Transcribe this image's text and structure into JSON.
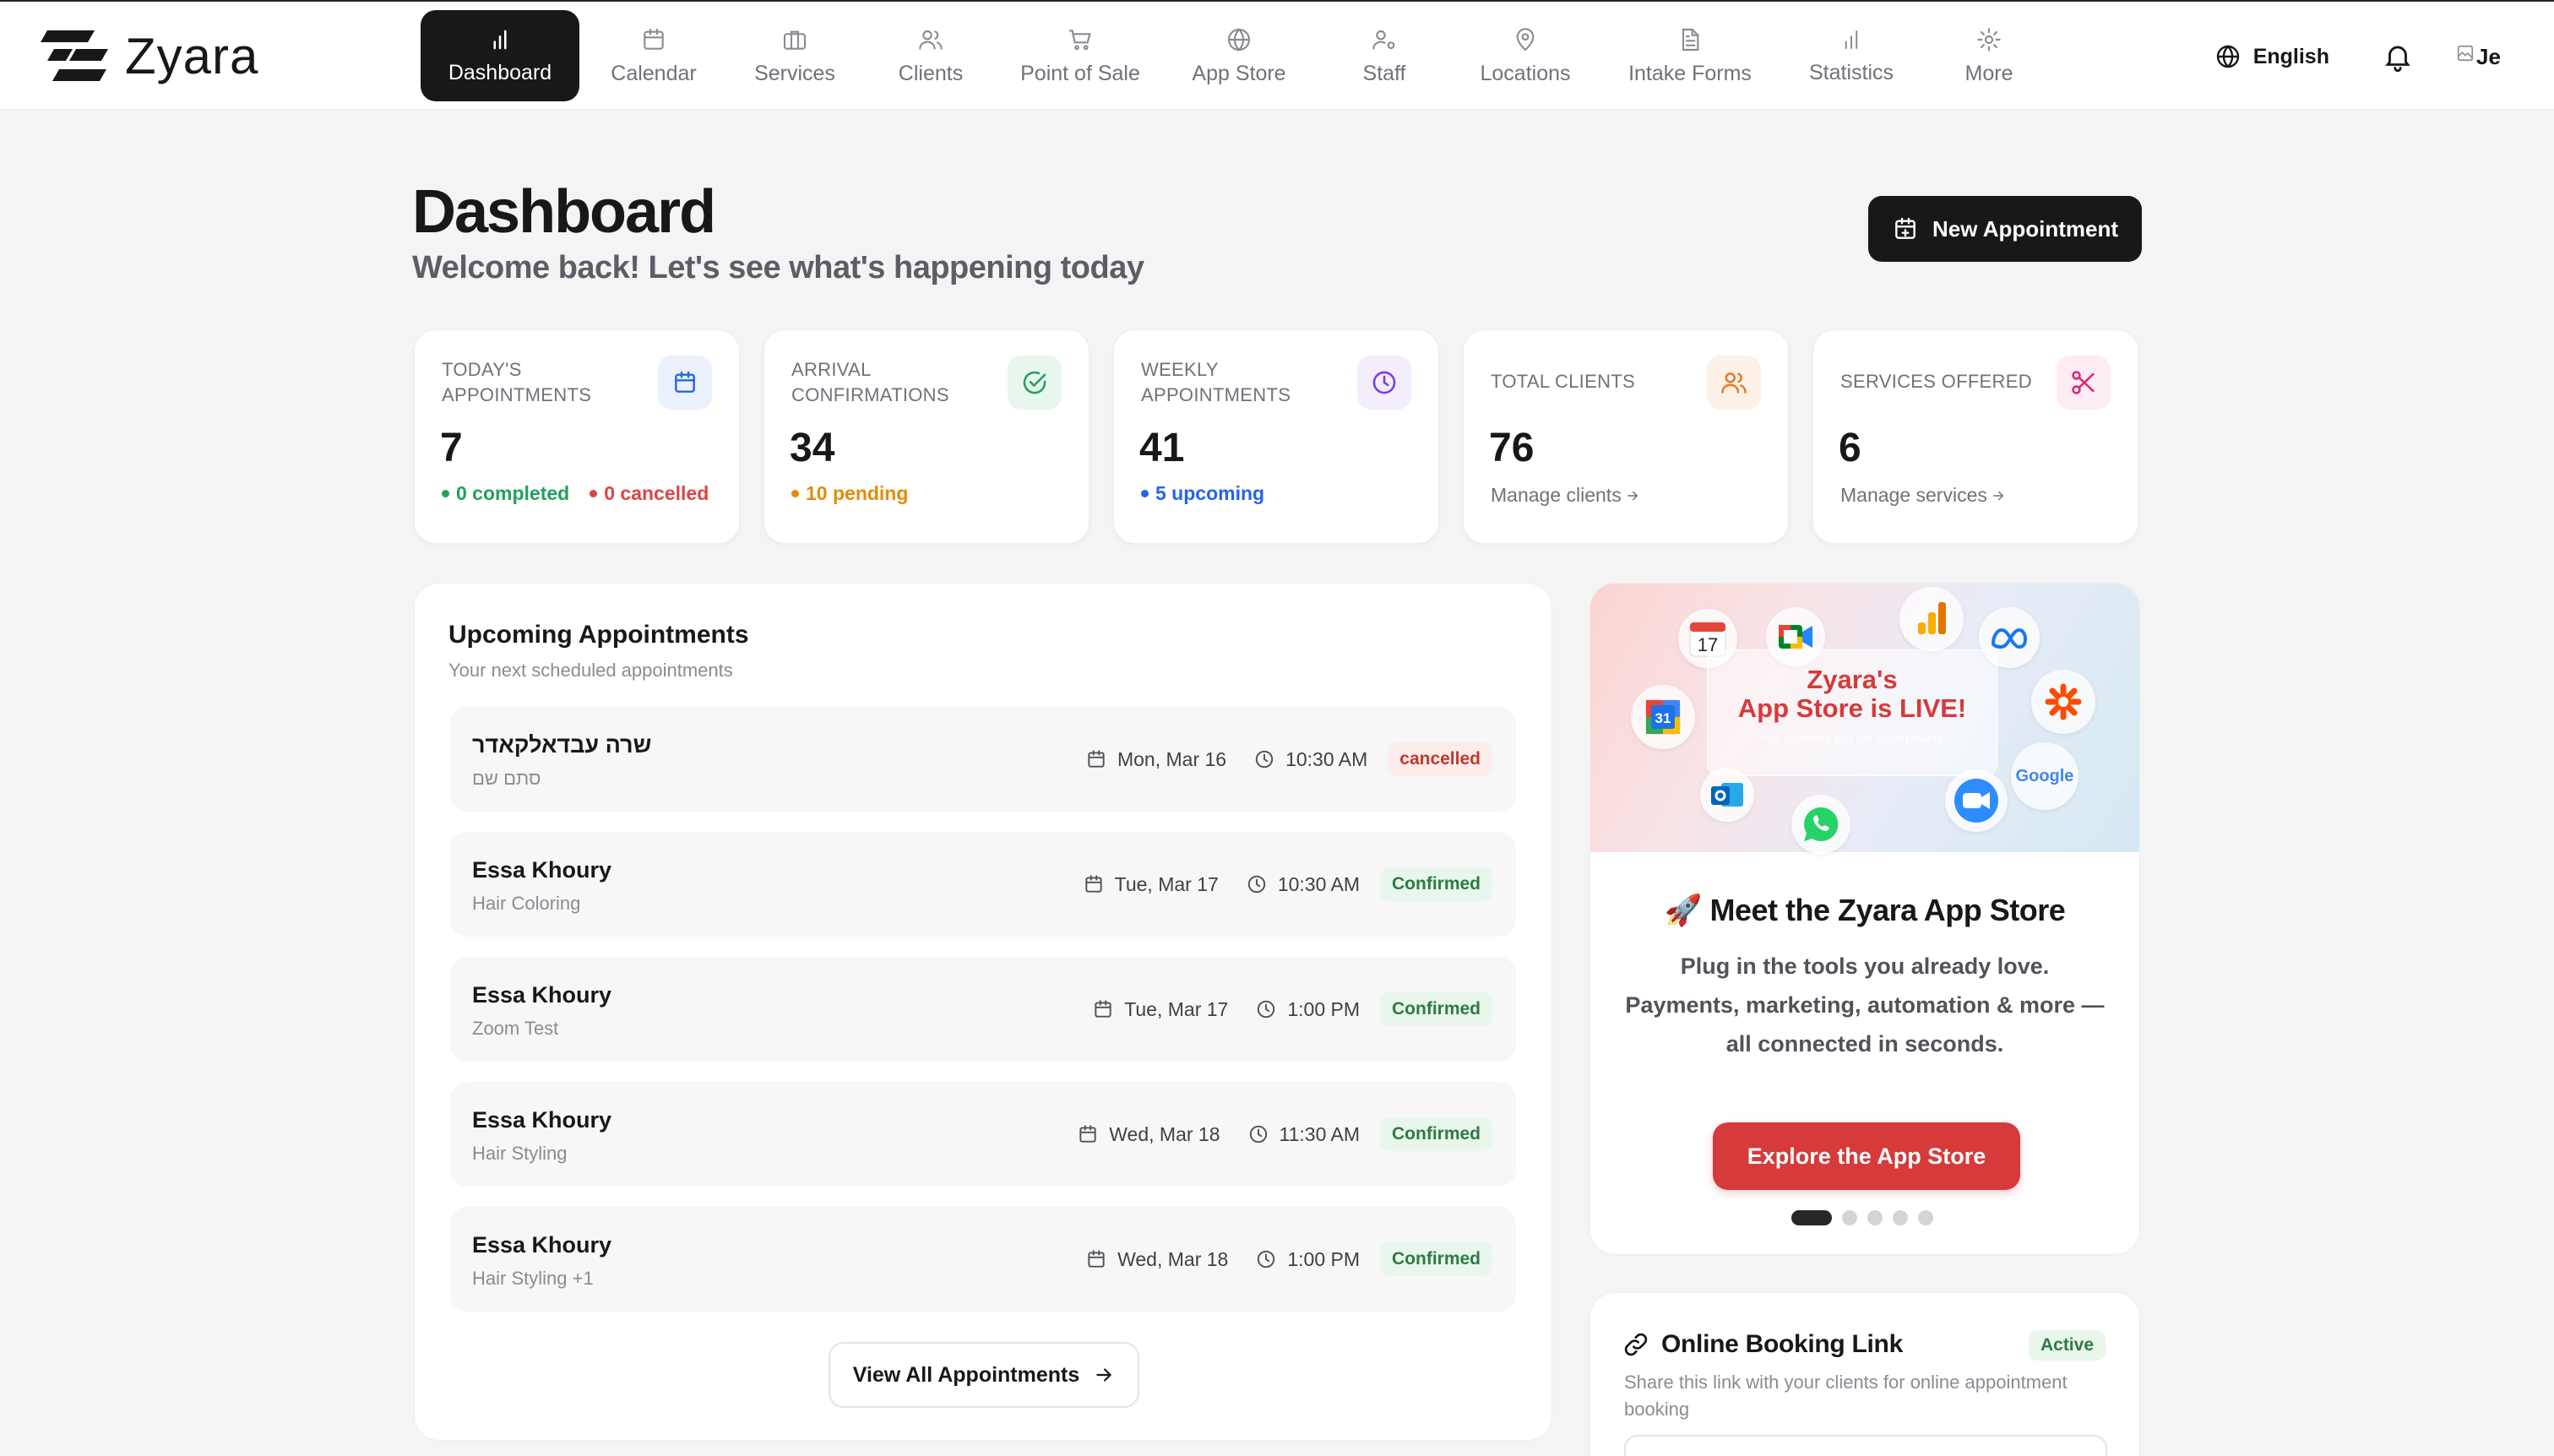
{
  "app": {
    "name": "Zyara"
  },
  "nav": {
    "items": [
      {
        "label": "Dashboard",
        "icon": "bar-chart-icon",
        "active": true
      },
      {
        "label": "Calendar",
        "icon": "calendar-icon"
      },
      {
        "label": "Services",
        "icon": "briefcase-icon"
      },
      {
        "label": "Clients",
        "icon": "users-icon"
      },
      {
        "label": "Point of Sale",
        "icon": "cart-icon"
      },
      {
        "label": "App Store",
        "icon": "globe-icon"
      },
      {
        "label": "Staff",
        "icon": "user-cog-icon"
      },
      {
        "label": "Locations",
        "icon": "map-pin-icon"
      },
      {
        "label": "Intake Forms",
        "icon": "file-text-icon"
      },
      {
        "label": "Statistics",
        "icon": "bar-chart-icon"
      },
      {
        "label": "More",
        "icon": "gear-icon"
      }
    ],
    "language": "English",
    "avatar_alt": "Je"
  },
  "header": {
    "title": "Dashboard",
    "subtitle": "Welcome back! Let's see what's happening today",
    "new_appointment": "New Appointment"
  },
  "stats": [
    {
      "label": "Today's Appointments",
      "value": "7",
      "icon": "calendar-icon",
      "color": "#2563eb",
      "footer": [
        {
          "text": "0 completed",
          "color": "#22a05a"
        },
        {
          "text": "0 cancelled",
          "color": "#dc4444"
        }
      ]
    },
    {
      "label": "Arrival Confirmations",
      "value": "34",
      "icon": "check-circle-icon",
      "color": "#22a05a",
      "footer": [
        {
          "text": "10 pending",
          "color": "#e48a0c"
        }
      ]
    },
    {
      "label": "Weekly Appointments",
      "value": "41",
      "icon": "clock-icon",
      "color": "#7c3aed",
      "footer": [
        {
          "text": "5 upcoming",
          "color": "#2563eb"
        }
      ]
    },
    {
      "label": "Total Clients",
      "value": "76",
      "icon": "users-icon",
      "color": "#ea7a2c",
      "link": "Manage clients"
    },
    {
      "label": "Services Offered",
      "value": "6",
      "icon": "scissors-icon",
      "color": "#db2777",
      "link": "Manage services"
    }
  ],
  "appointments": {
    "title": "Upcoming Appointments",
    "subtitle": "Your next scheduled appointments",
    "rows": [
      {
        "name": "שרה עבדאלקאדר",
        "service": "סתם שם",
        "date": "Mon, Mar 16",
        "time": "10:30 AM",
        "status": "cancelled"
      },
      {
        "name": "Essa Khoury",
        "service": "Hair Coloring",
        "date": "Tue, Mar 17",
        "time": "10:30 AM",
        "status": "Confirmed"
      },
      {
        "name": "Essa Khoury",
        "service": "Zoom Test",
        "date": "Tue, Mar 17",
        "time": "1:00 PM",
        "status": "Confirmed"
      },
      {
        "name": "Essa Khoury",
        "service": "Hair Styling",
        "date": "Wed, Mar 18",
        "time": "11:30 AM",
        "status": "Confirmed"
      },
      {
        "name": "Essa Khoury",
        "service": "Hair Styling +1",
        "date": "Wed, Mar 18",
        "time": "1:00 PM",
        "status": "Confirmed"
      }
    ],
    "view_all": "View All Appointments"
  },
  "promo": {
    "banner_line1": "Zyara's",
    "banner_line2": "App Store is LIVE!",
    "banner_line3": "Your business just got superpowers.",
    "calendar_day": "17",
    "outlook_day": "31",
    "google_label": "Google",
    "title": "🚀 Meet the Zyara App Store",
    "text": "Plug in the tools you already love. Payments, marketing, automation & more — all connected in seconds.",
    "button": "Explore the App Store",
    "slides": 5,
    "active_slide": 1
  },
  "booking": {
    "title": "Online Booking Link",
    "status": "Active",
    "description": "Share this link with your clients for online appointment booking"
  },
  "colors": {
    "primary_dark": "#18181b",
    "accent_red": "#d63a3a",
    "confirmed_green": "#2f7a45",
    "cancelled_red": "#c0392b"
  }
}
